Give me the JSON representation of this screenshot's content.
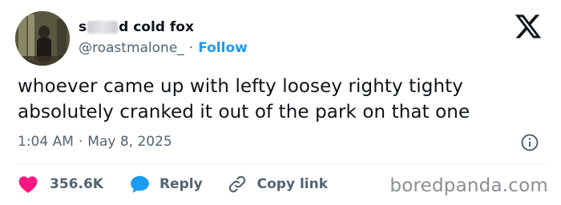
{
  "author": {
    "name_start": "s",
    "name_end": "d cold fox",
    "handle": "@roastmalone_",
    "separator": "·",
    "follow_label": "Follow"
  },
  "tweet": {
    "text_lines": [
      "whoever came up with lefty loosey righty tighty",
      "absolutely cranked it out of the park on that one"
    ],
    "time": "1:04 AM",
    "time_separator": "·",
    "date": "May 8, 2025"
  },
  "actions": {
    "like_count": "356.6K",
    "reply_label": "Reply",
    "copy_link_label": "Copy link"
  },
  "watermark": "boredpanda.com",
  "icons": {
    "logo": "x-logo-icon",
    "info": "info-icon",
    "like": "heart-icon",
    "reply": "speech-bubble-icon",
    "copy": "link-icon"
  },
  "colors": {
    "text": "#0f1419",
    "muted": "#536471",
    "link": "#1d9bf0",
    "like": "#f91880",
    "reply": "#1d9bf0",
    "divider": "#eff3f4",
    "watermark": "#8a8f94"
  }
}
